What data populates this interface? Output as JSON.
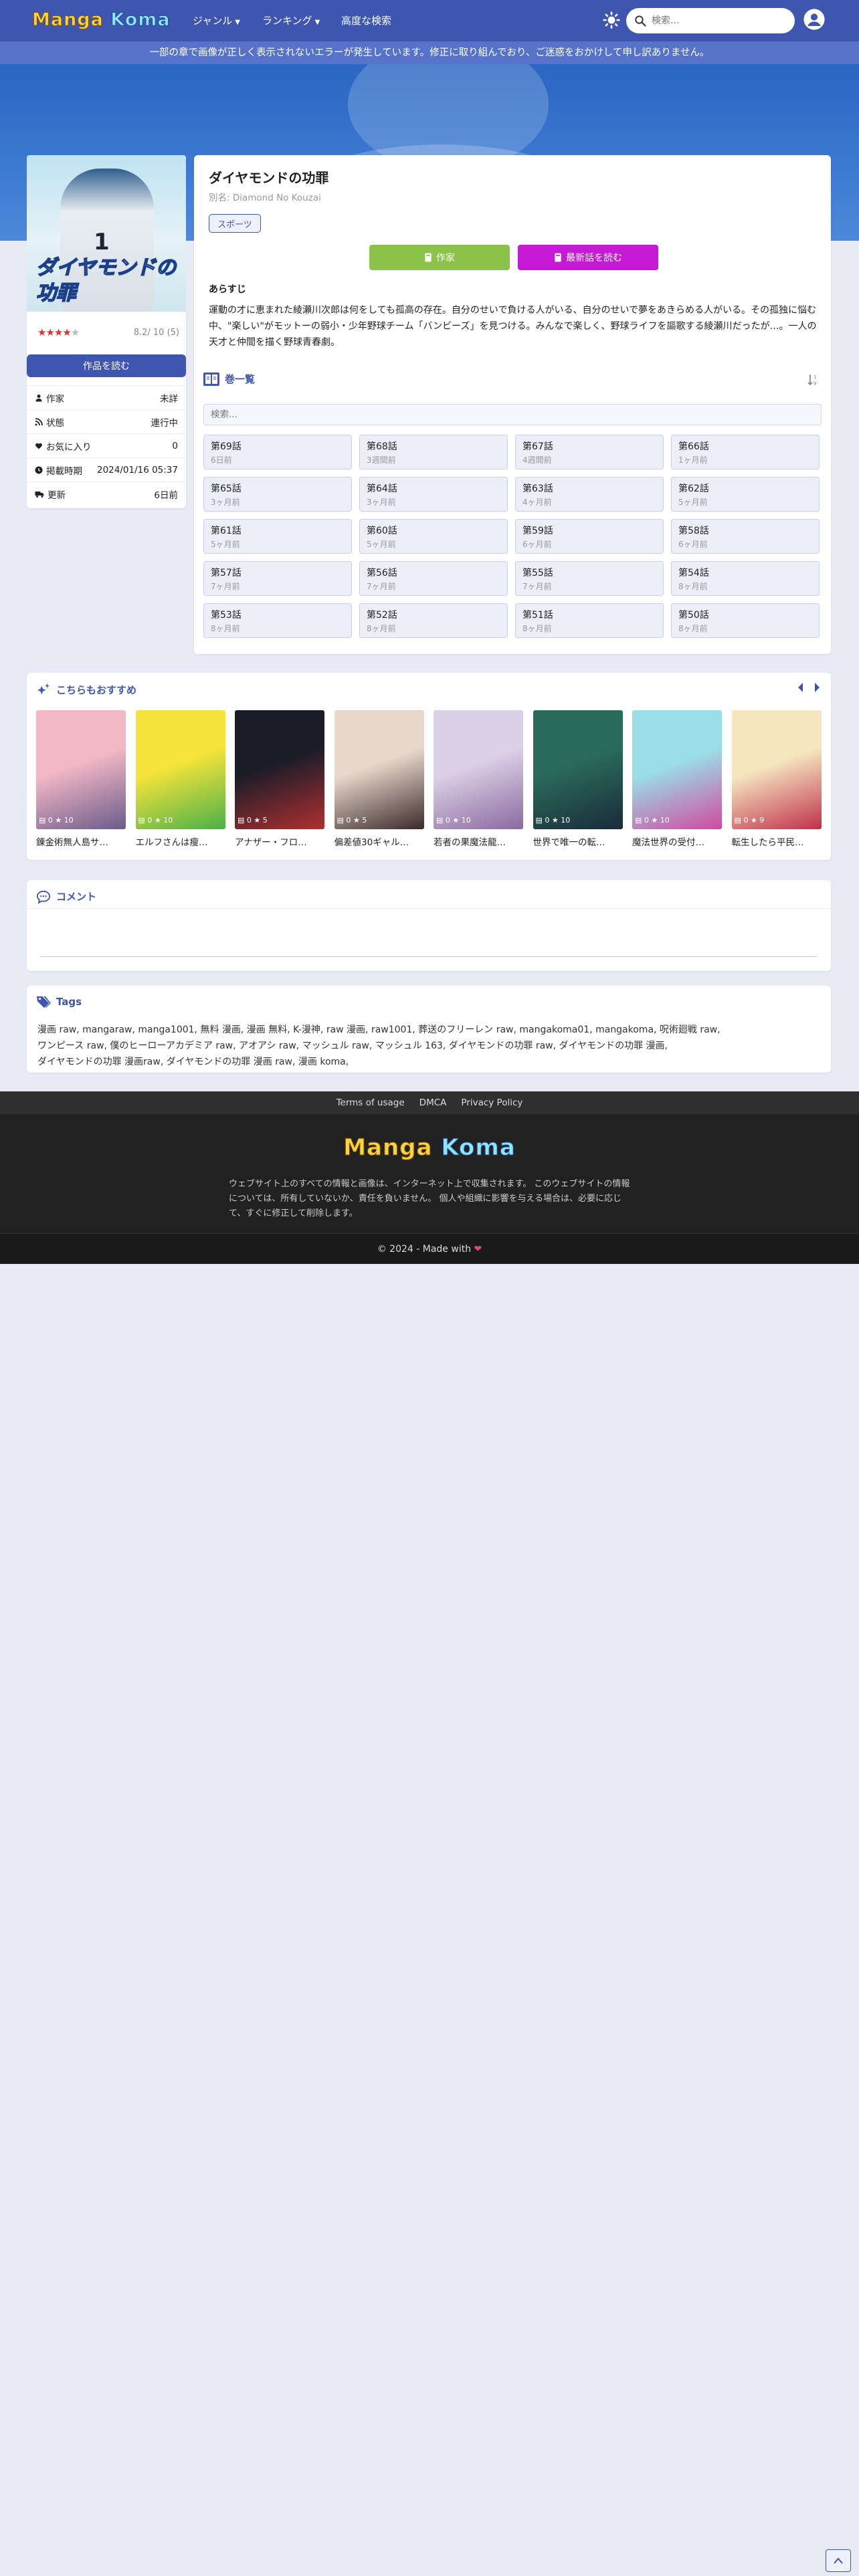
{
  "header": {
    "logo_part1": "Manga",
    "logo_part2": "Koma",
    "nav": [
      {
        "label": "ジャンル",
        "dropdown": true
      },
      {
        "label": "ランキング",
        "dropdown": true
      },
      {
        "label": "高度な検索",
        "dropdown": false
      }
    ],
    "search_placeholder": "検索..."
  },
  "alert": "一部の章で画像が正しく表示されないエラーが発生しています。修正に取り組んでおり、ご迷惑をおかけして申し訳ありません。",
  "manga": {
    "cover_number": "1",
    "cover_title": "ダイヤモンドの功罪",
    "rating_stars": 4,
    "rating_text": "8.2/ 10 (5)",
    "read_label": "作品を読む",
    "info": [
      {
        "icon": "user-icon",
        "key": "作家",
        "value": "未詳"
      },
      {
        "icon": "rss-icon",
        "key": "状態",
        "value": "連行中"
      },
      {
        "icon": "heart-icon",
        "key": "お気に入り",
        "value": "0"
      },
      {
        "icon": "clock-icon",
        "key": "掲載時期",
        "value": "2024/01/16 05:37"
      },
      {
        "icon": "truck-icon",
        "key": "更新",
        "value": "6日前"
      }
    ],
    "title": "ダイヤモンドの功罪",
    "alt_title": "別名: Diamond No Kouzai",
    "genre": "スポーツ",
    "author_btn": "作家",
    "latest_btn": "最新話を読む",
    "synopsis_heading": "あらすじ",
    "synopsis": "運動の才に恵まれた綾瀬川次郎は何をしても孤高の存在。自分のせいで負ける人がいる、自分のせいで夢をあきらめる人がいる。その孤独に悩む中、\"楽しい\"がモットーの弱小・少年野球チーム「バンビーズ」を見つける。みんなで楽しく、野球ライフを謳歌する綾瀬川だったが…。一人の天才と仲間を描く野球青春劇。"
  },
  "chapters": {
    "heading": "巻一覧",
    "search_placeholder": "検索...",
    "items": [
      {
        "name": "第69話",
        "date": "6日前"
      },
      {
        "name": "第68話",
        "date": "3週間前"
      },
      {
        "name": "第67話",
        "date": "4週間前"
      },
      {
        "name": "第66話",
        "date": "1ヶ月前"
      },
      {
        "name": "第65話",
        "date": "3ヶ月前"
      },
      {
        "name": "第64話",
        "date": "3ヶ月前"
      },
      {
        "name": "第63話",
        "date": "4ヶ月前"
      },
      {
        "name": "第62話",
        "date": "5ヶ月前"
      },
      {
        "name": "第61話",
        "date": "5ヶ月前"
      },
      {
        "name": "第60話",
        "date": "5ヶ月前"
      },
      {
        "name": "第59話",
        "date": "6ヶ月前"
      },
      {
        "name": "第58話",
        "date": "6ヶ月前"
      },
      {
        "name": "第57話",
        "date": "7ヶ月前"
      },
      {
        "name": "第56話",
        "date": "7ヶ月前"
      },
      {
        "name": "第55話",
        "date": "7ヶ月前"
      },
      {
        "name": "第54話",
        "date": "8ヶ月前"
      },
      {
        "name": "第53話",
        "date": "8ヶ月前"
      },
      {
        "name": "第52話",
        "date": "8ヶ月前"
      },
      {
        "name": "第51話",
        "date": "8ヶ月前"
      },
      {
        "name": "第50話",
        "date": "8ヶ月前"
      }
    ]
  },
  "recommend": {
    "heading": "こちらもおすすめ",
    "items": [
      {
        "name": "錬金術無人島サ…",
        "views": "0",
        "favs": "10",
        "color1": "#f2b8c6",
        "color2": "#6b5b8a"
      },
      {
        "name": "エルフさんは瘦…",
        "views": "0",
        "favs": "10",
        "color1": "#f5e43a",
        "color2": "#4ab04a"
      },
      {
        "name": "アナザー・フロ…",
        "views": "0",
        "favs": "5",
        "color1": "#1c1c28",
        "color2": "#b03030"
      },
      {
        "name": "偏差値30ギャル…",
        "views": "0",
        "favs": "5",
        "color1": "#e8d8cc",
        "color2": "#3a2a2a"
      },
      {
        "name": "若者の果魔法龍…",
        "views": "0",
        "favs": "10",
        "color1": "#dcd0e6",
        "color2": "#8a6aa0"
      },
      {
        "name": "世界で唯一の転…",
        "views": "0",
        "favs": "10",
        "color1": "#2a6a5a",
        "color2": "#1a2a3a"
      },
      {
        "name": "魔法世界の受付…",
        "views": "0",
        "favs": "10",
        "color1": "#9adfe8",
        "color2": "#d04aa0"
      },
      {
        "name": "転生したら平民…",
        "views": "0",
        "favs": "9",
        "color1": "#f6e6c0",
        "color2": "#c0304a"
      }
    ]
  },
  "comment": {
    "heading": "コメント"
  },
  "tags": {
    "heading": "Tags",
    "line1": "漫画 raw, mangaraw, manga1001, 無料 漫画, 漫画 無料, K-漫神, raw 漫画, raw1001, 葬送のフリーレン raw, mangakoma01, mangakoma, 呪術廻戦 raw,",
    "line2": "ワンピース raw, 僕のヒーローアカデミア raw, アオアシ raw, マッシュル raw, マッシュル 163, ダイヤモンドの功罪 raw, ダイヤモンドの功罪 漫画,",
    "line3": "ダイヤモンドの功罪 漫画raw, ダイヤモンドの功罪 漫画 raw, 漫画 koma,"
  },
  "footer": {
    "links": [
      "Terms of usage",
      "DMCA",
      "Privacy Policy"
    ],
    "desc1": "ウェブサイト上のすべての情報と画像は、インターネット上で収集されます。 このウェブサイトの情報",
    "desc2": "については、所有していないか、責任を負いません。 個人や組織に影響を与える場合は、必要に応じ",
    "desc3": "て、すぐに修正して削除します。",
    "copyright": "© 2024 - Made with"
  },
  "colors": {
    "primary": "#3f56b0",
    "author_btn": "#8bc34a",
    "latest_btn": "#c619d6",
    "star": "#e03030"
  }
}
